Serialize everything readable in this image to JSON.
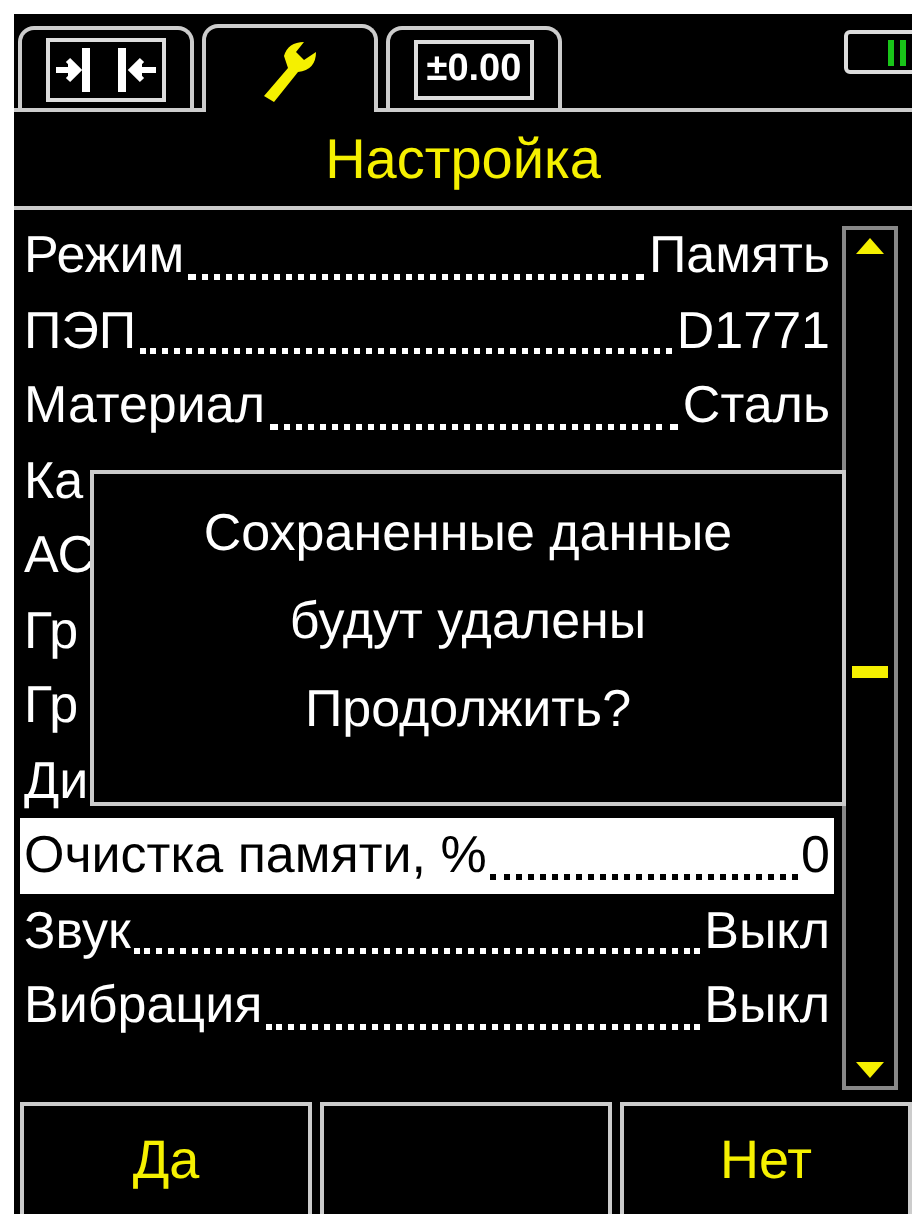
{
  "tabs": [
    {
      "kind": "ends",
      "selected": false
    },
    {
      "kind": "wrench",
      "selected": true
    },
    {
      "kind": "offset",
      "label": "±0.00",
      "selected": false
    }
  ],
  "title": "Настройка",
  "rows": [
    {
      "label": "Режим",
      "value": "Память",
      "selected": false
    },
    {
      "label": "ПЭП",
      "value": "D1771",
      "selected": false
    },
    {
      "label": "Материал",
      "value": "Сталь",
      "selected": false
    },
    {
      "label": "Ка",
      "selected": false
    },
    {
      "label": "АС",
      "selected": false
    },
    {
      "label": "Гр",
      "selected": false
    },
    {
      "label": "Гр",
      "selected": false
    },
    {
      "label": "Ди",
      "selected": false
    },
    {
      "label": "Очистка памяти, %",
      "value": "0",
      "selected": true
    },
    {
      "label": "Звук",
      "value": "Выкл",
      "selected": false
    },
    {
      "label": "Вибрация",
      "value": "Выкл",
      "selected": false
    }
  ],
  "dialog": {
    "lines": [
      "Сохраненные данные",
      "будут удалены",
      "Продолжить?"
    ]
  },
  "buttons": [
    {
      "kind": "text",
      "label": "Да"
    },
    {
      "kind": "blank"
    },
    {
      "kind": "text",
      "label": "Нет"
    }
  ]
}
